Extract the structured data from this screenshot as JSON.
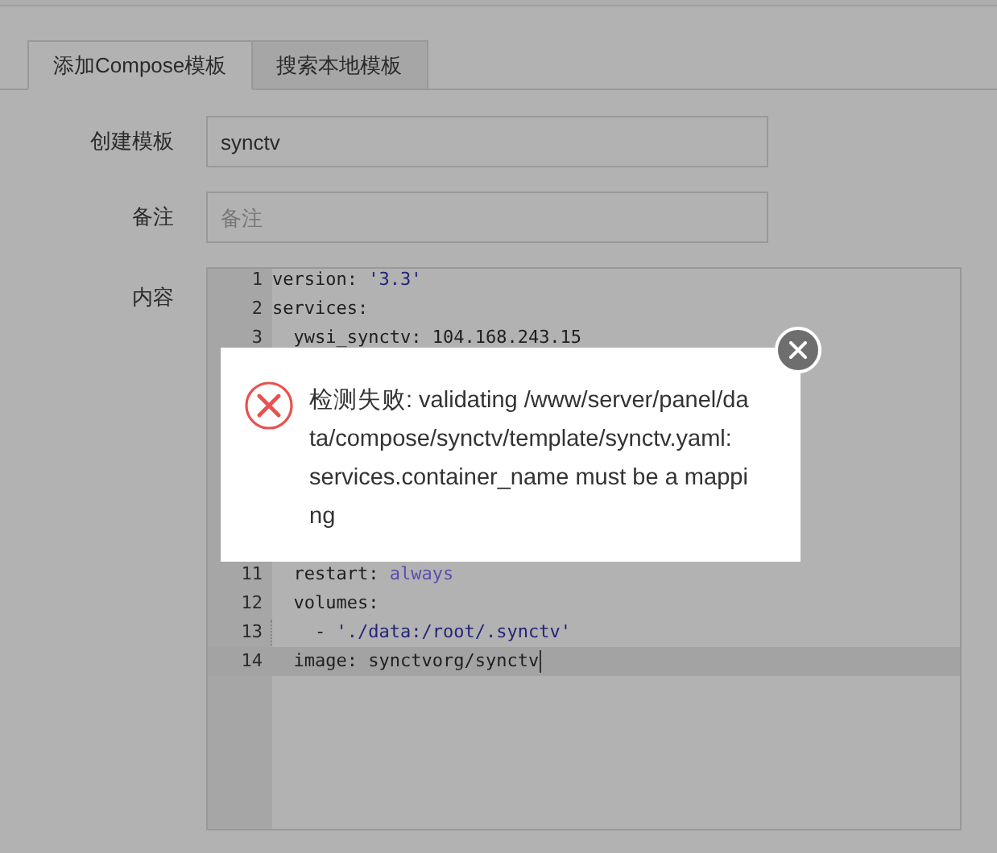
{
  "tabs": [
    {
      "label": "添加Compose模板",
      "selected": true
    },
    {
      "label": "搜索本地模板",
      "selected": false
    }
  ],
  "form": {
    "name_label": "创建模板",
    "name_value": "synctv",
    "note_label": "备注",
    "note_placeholder": "备注",
    "content_label": "内容"
  },
  "editor": {
    "lines": [
      {
        "number": "1",
        "active": false,
        "guide": false,
        "segments": [
          {
            "text": "version: ",
            "kind": "plain"
          },
          {
            "text": "'3.3'",
            "kind": "string"
          }
        ]
      },
      {
        "number": "2",
        "active": false,
        "guide": false,
        "segments": [
          {
            "text": "services:",
            "kind": "plain"
          }
        ]
      },
      {
        "number": "3",
        "active": false,
        "guide": false,
        "segments": [
          {
            "text": "  ywsi_synctv: 104.168.243.15",
            "kind": "plain"
          }
        ]
      },
      {
        "number": "11",
        "active": false,
        "guide": false,
        "segments": [
          {
            "text": "  restart: ",
            "kind": "plain"
          },
          {
            "text": "always",
            "kind": "keyword"
          }
        ]
      },
      {
        "number": "12",
        "active": false,
        "guide": false,
        "segments": [
          {
            "text": "  volumes:",
            "kind": "plain"
          }
        ]
      },
      {
        "number": "13",
        "active": false,
        "guide": true,
        "segments": [
          {
            "text": "    - ",
            "kind": "plain"
          },
          {
            "text": "'./data:/root/.synctv'",
            "kind": "string"
          }
        ]
      },
      {
        "number": "14",
        "active": true,
        "guide": false,
        "segments": [
          {
            "text": "  image: synctvorg/synctv",
            "kind": "plain"
          }
        ]
      }
    ]
  },
  "dialog": {
    "message_lines": [
      "检测失败: validating /www/server/panel/da",
      "ta/compose/synctv/template/synctv.yaml:",
      "services.container_name must be a mappi",
      "ng"
    ]
  }
}
